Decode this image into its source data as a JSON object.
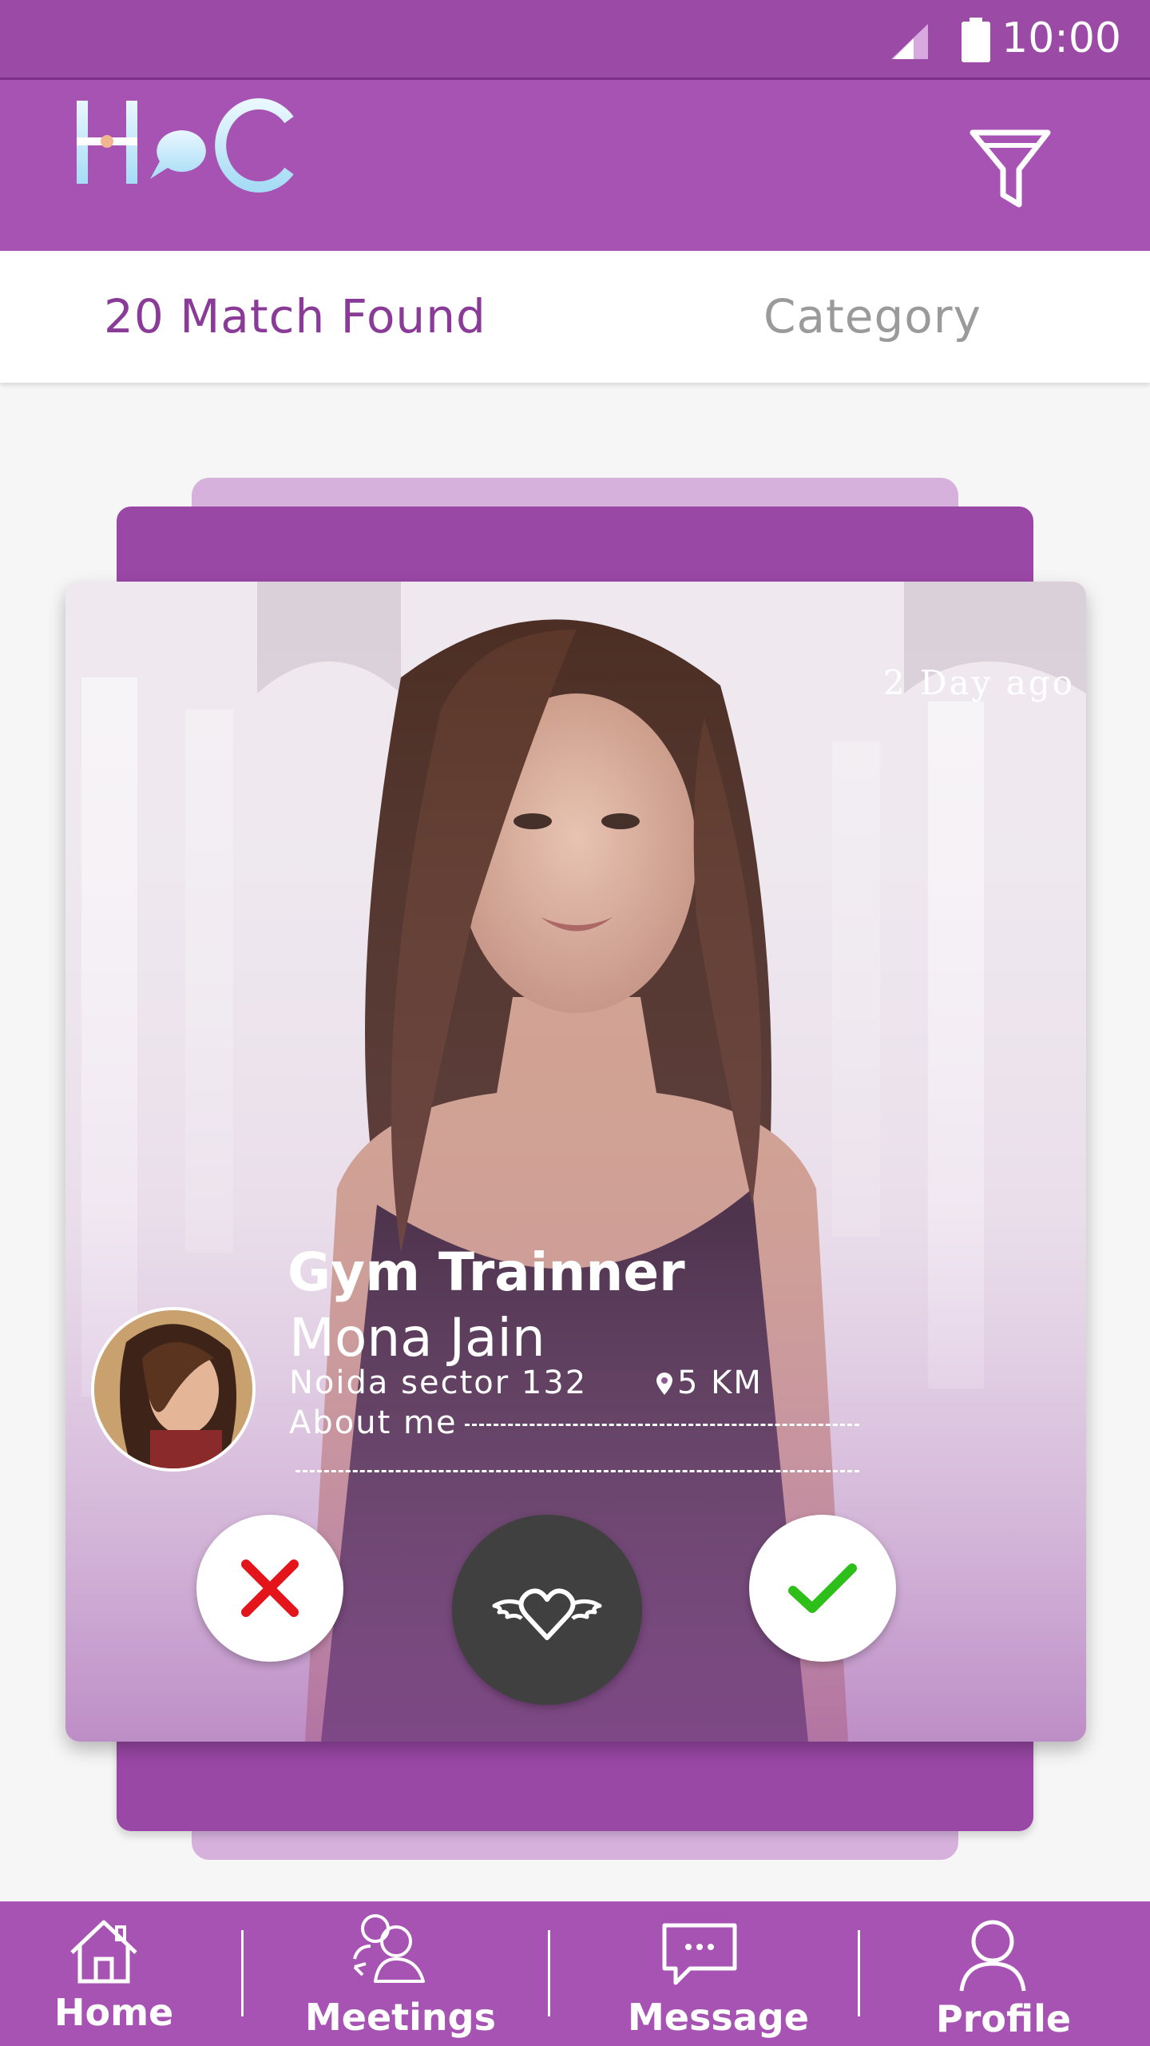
{
  "status_bar": {
    "time": "10:00"
  },
  "app_bar": {
    "logo_text": "HoC"
  },
  "tabs": {
    "match_found": "20 Match Found",
    "category": "Category"
  },
  "card": {
    "time_ago": "2 Day ago",
    "job_title": "Gym Trainner",
    "name": "Mona Jain",
    "location": "Noida sector 132",
    "distance": "5 KM",
    "about_label": "About me"
  },
  "bottom_nav": {
    "items": [
      {
        "label": "Home",
        "icon": "home-icon"
      },
      {
        "label": "Meetings",
        "icon": "meetings-icon"
      },
      {
        "label": "Message",
        "icon": "message-icon"
      },
      {
        "label": "Profile",
        "icon": "profile-icon"
      }
    ]
  },
  "colors": {
    "primary": "#a753b3",
    "primary_dark": "#9b4aa5",
    "reject": "#e3151a",
    "accept": "#2fbf1a",
    "super_like_bg": "#404040"
  }
}
